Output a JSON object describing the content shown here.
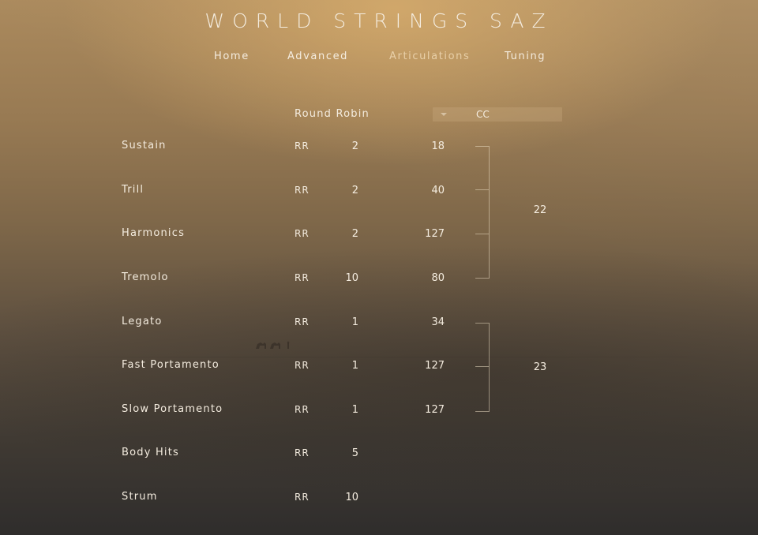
{
  "app": {
    "title": "WORLD STRINGS SAZ"
  },
  "nav": {
    "tabs": [
      {
        "label": "Home"
      },
      {
        "label": "Advanced"
      },
      {
        "label": "Articulations"
      },
      {
        "label": "Tuning"
      }
    ],
    "active": "Articulations"
  },
  "columns": {
    "round_robin": "Round Robin",
    "cc_select": "CC"
  },
  "articulations": [
    {
      "name": "Sustain",
      "rr_label": "RR",
      "rr": "2",
      "cc": "18"
    },
    {
      "name": "Trill",
      "rr_label": "RR",
      "rr": "2",
      "cc": "40"
    },
    {
      "name": "Harmonics",
      "rr_label": "RR",
      "rr": "2",
      "cc": "127"
    },
    {
      "name": "Tremolo",
      "rr_label": "RR",
      "rr": "10",
      "cc": "80"
    },
    {
      "name": "Legato",
      "rr_label": "RR",
      "rr": "1",
      "cc": "34"
    },
    {
      "name": "Fast Portamento",
      "rr_label": "RR",
      "rr": "1",
      "cc": "127"
    },
    {
      "name": "Slow Portamento",
      "rr_label": "RR",
      "rr": "1",
      "cc": "127"
    },
    {
      "name": "Body Hits",
      "rr_label": "RR",
      "rr": "5",
      "cc": ""
    },
    {
      "name": "Strum",
      "rr_label": "RR",
      "rr": "10",
      "cc": ""
    }
  ],
  "cc_groups": [
    {
      "value": "22"
    },
    {
      "value": "23"
    }
  ],
  "icons": {
    "dropdown": "caret-down-icon",
    "background": "desert-caravan"
  },
  "colors": {
    "text": "#f4ecdf",
    "accent": "#efd9b4"
  }
}
